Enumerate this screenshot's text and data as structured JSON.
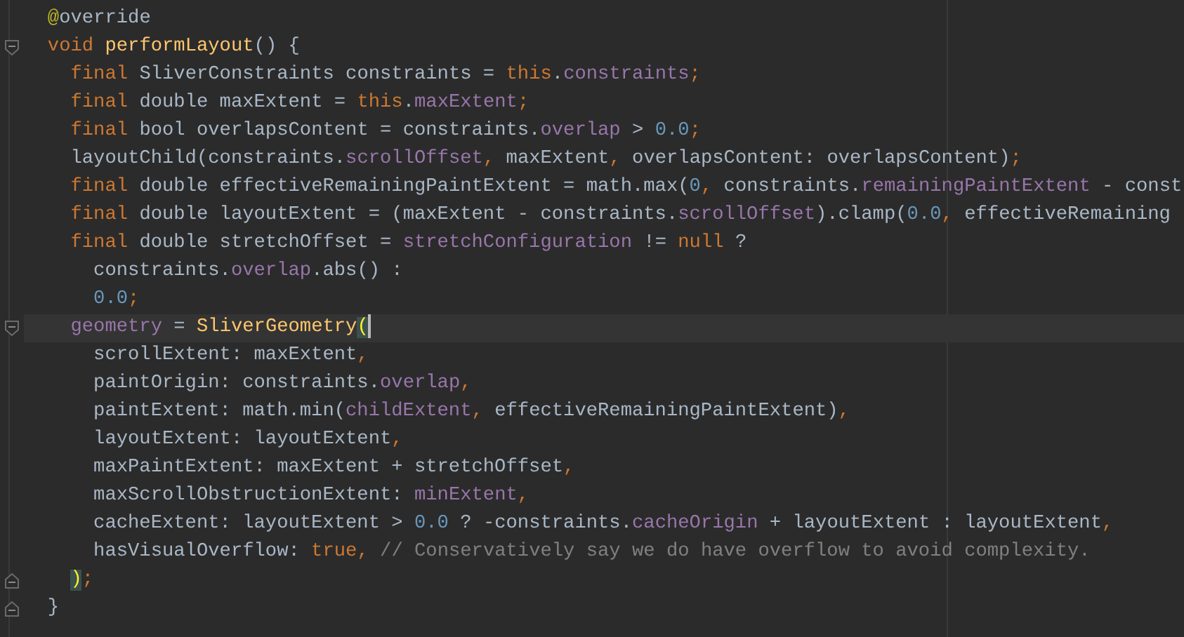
{
  "editor": {
    "lines": [
      {
        "fold_open": false,
        "fold_close": false,
        "current": false,
        "tokens": [
          {
            "kind": "annotation",
            "text": "  @"
          },
          {
            "kind": "plain",
            "text": "override"
          }
        ]
      },
      {
        "fold_open": true,
        "fold_close": false,
        "current": false,
        "tokens": [
          {
            "kind": "keyword",
            "text": "  void "
          },
          {
            "kind": "function",
            "text": "performLayout"
          },
          {
            "kind": "plain",
            "text": "() {"
          }
        ]
      },
      {
        "fold_open": false,
        "fold_close": false,
        "current": false,
        "tokens": [
          {
            "kind": "keyword",
            "text": "    final"
          },
          {
            "kind": "plain",
            "text": " SliverConstraints constraints = "
          },
          {
            "kind": "keyword",
            "text": "this"
          },
          {
            "kind": "plain",
            "text": "."
          },
          {
            "kind": "field",
            "text": "constraints"
          },
          {
            "kind": "keyword",
            "text": ";"
          }
        ]
      },
      {
        "fold_open": false,
        "fold_close": false,
        "current": false,
        "tokens": [
          {
            "kind": "keyword",
            "text": "    final"
          },
          {
            "kind": "plain",
            "text": " double maxExtent = "
          },
          {
            "kind": "keyword",
            "text": "this"
          },
          {
            "kind": "plain",
            "text": "."
          },
          {
            "kind": "field",
            "text": "maxExtent"
          },
          {
            "kind": "keyword",
            "text": ";"
          }
        ]
      },
      {
        "fold_open": false,
        "fold_close": false,
        "current": false,
        "tokens": [
          {
            "kind": "keyword",
            "text": "    final"
          },
          {
            "kind": "plain",
            "text": " bool overlapsContent = constraints."
          },
          {
            "kind": "field",
            "text": "overlap"
          },
          {
            "kind": "plain",
            "text": " > "
          },
          {
            "kind": "number",
            "text": "0.0"
          },
          {
            "kind": "keyword",
            "text": ";"
          }
        ]
      },
      {
        "fold_open": false,
        "fold_close": false,
        "current": false,
        "tokens": [
          {
            "kind": "plain",
            "text": "    layoutChild(constraints."
          },
          {
            "kind": "field",
            "text": "scrollOffset"
          },
          {
            "kind": "keyword",
            "text": ","
          },
          {
            "kind": "plain",
            "text": " maxExtent"
          },
          {
            "kind": "keyword",
            "text": ","
          },
          {
            "kind": "plain",
            "text": " overlapsContent: overlapsContent)"
          },
          {
            "kind": "keyword",
            "text": ";"
          }
        ]
      },
      {
        "fold_open": false,
        "fold_close": false,
        "current": false,
        "tokens": [
          {
            "kind": "keyword",
            "text": "    final"
          },
          {
            "kind": "plain",
            "text": " double effectiveRemainingPaintExtent = math.max("
          },
          {
            "kind": "number",
            "text": "0"
          },
          {
            "kind": "keyword",
            "text": ","
          },
          {
            "kind": "plain",
            "text": " constraints."
          },
          {
            "kind": "field",
            "text": "remainingPaintExtent"
          },
          {
            "kind": "plain",
            "text": " - const"
          }
        ]
      },
      {
        "fold_open": false,
        "fold_close": false,
        "current": false,
        "tokens": [
          {
            "kind": "keyword",
            "text": "    final"
          },
          {
            "kind": "plain",
            "text": " double layoutExtent = (maxExtent - constraints."
          },
          {
            "kind": "field",
            "text": "scrollOffset"
          },
          {
            "kind": "plain",
            "text": ").clamp("
          },
          {
            "kind": "number",
            "text": "0.0"
          },
          {
            "kind": "keyword",
            "text": ","
          },
          {
            "kind": "plain",
            "text": " effectiveRemaining"
          }
        ]
      },
      {
        "fold_open": false,
        "fold_close": false,
        "current": false,
        "tokens": [
          {
            "kind": "keyword",
            "text": "    final"
          },
          {
            "kind": "plain",
            "text": " double stretchOffset = "
          },
          {
            "kind": "field",
            "text": "stretchConfiguration"
          },
          {
            "kind": "plain",
            "text": " != "
          },
          {
            "kind": "keyword",
            "text": "null"
          },
          {
            "kind": "plain",
            "text": " ?"
          }
        ]
      },
      {
        "fold_open": false,
        "fold_close": false,
        "current": false,
        "tokens": [
          {
            "kind": "plain",
            "text": "      constraints."
          },
          {
            "kind": "field",
            "text": "overlap"
          },
          {
            "kind": "plain",
            "text": ".abs() :"
          }
        ]
      },
      {
        "fold_open": false,
        "fold_close": false,
        "current": false,
        "tokens": [
          {
            "kind": "number",
            "text": "      0.0"
          },
          {
            "kind": "keyword",
            "text": ";"
          }
        ]
      },
      {
        "fold_open": true,
        "fold_close": false,
        "current": true,
        "tokens": [
          {
            "kind": "field",
            "text": "    geometry"
          },
          {
            "kind": "plain",
            "text": " = "
          },
          {
            "kind": "function",
            "text": "SliverGeometry"
          },
          {
            "kind": "brace_match",
            "text": "(",
            "caret": true
          }
        ]
      },
      {
        "fold_open": false,
        "fold_close": false,
        "current": false,
        "tokens": [
          {
            "kind": "plain",
            "text": "      scrollExtent: maxExtent"
          },
          {
            "kind": "keyword",
            "text": ","
          }
        ]
      },
      {
        "fold_open": false,
        "fold_close": false,
        "current": false,
        "tokens": [
          {
            "kind": "plain",
            "text": "      paintOrigin: constraints."
          },
          {
            "kind": "field",
            "text": "overlap"
          },
          {
            "kind": "keyword",
            "text": ","
          }
        ]
      },
      {
        "fold_open": false,
        "fold_close": false,
        "current": false,
        "tokens": [
          {
            "kind": "plain",
            "text": "      paintExtent: math.min("
          },
          {
            "kind": "field",
            "text": "childExtent"
          },
          {
            "kind": "keyword",
            "text": ","
          },
          {
            "kind": "plain",
            "text": " effectiveRemainingPaintExtent)"
          },
          {
            "kind": "keyword",
            "text": ","
          }
        ]
      },
      {
        "fold_open": false,
        "fold_close": false,
        "current": false,
        "tokens": [
          {
            "kind": "plain",
            "text": "      layoutExtent: layoutExtent"
          },
          {
            "kind": "keyword",
            "text": ","
          }
        ]
      },
      {
        "fold_open": false,
        "fold_close": false,
        "current": false,
        "tokens": [
          {
            "kind": "plain",
            "text": "      maxPaintExtent: maxExtent + stretchOffset"
          },
          {
            "kind": "keyword",
            "text": ","
          }
        ]
      },
      {
        "fold_open": false,
        "fold_close": false,
        "current": false,
        "tokens": [
          {
            "kind": "plain",
            "text": "      maxScrollObstructionExtent: "
          },
          {
            "kind": "field",
            "text": "minExtent"
          },
          {
            "kind": "keyword",
            "text": ","
          }
        ]
      },
      {
        "fold_open": false,
        "fold_close": false,
        "current": false,
        "tokens": [
          {
            "kind": "plain",
            "text": "      cacheExtent: layoutExtent > "
          },
          {
            "kind": "number",
            "text": "0.0"
          },
          {
            "kind": "plain",
            "text": " ? -constraints."
          },
          {
            "kind": "field",
            "text": "cacheOrigin"
          },
          {
            "kind": "plain",
            "text": " + layoutExtent : layoutExtent"
          },
          {
            "kind": "keyword",
            "text": ","
          }
        ]
      },
      {
        "fold_open": false,
        "fold_close": false,
        "current": false,
        "tokens": [
          {
            "kind": "plain",
            "text": "      hasVisualOverflow: "
          },
          {
            "kind": "keyword",
            "text": "true"
          },
          {
            "kind": "keyword",
            "text": ","
          },
          {
            "kind": "comment",
            "text": " // Conservatively say we do have overflow to avoid complexity."
          }
        ]
      },
      {
        "fold_open": false,
        "fold_close": true,
        "current": false,
        "tokens": [
          {
            "kind": "brace_match",
            "text": "    )"
          },
          {
            "kind": "keyword",
            "text": ";"
          }
        ]
      },
      {
        "fold_open": false,
        "fold_close": true,
        "current": false,
        "tokens": [
          {
            "kind": "plain",
            "text": "  }"
          }
        ]
      }
    ]
  }
}
